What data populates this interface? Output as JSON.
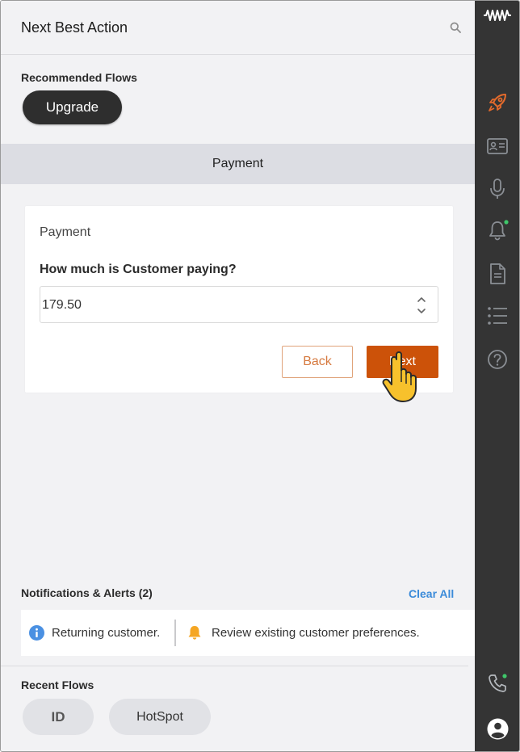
{
  "header": {
    "title": "Next Best Action",
    "search_icon": "search-icon"
  },
  "recommended": {
    "label": "Recommended Flows",
    "flows": [
      {
        "label": "Upgrade"
      }
    ]
  },
  "payment_section": {
    "label": "Payment"
  },
  "card": {
    "title": "Payment",
    "question": "How much is Customer paying?",
    "amount_value": "179.50",
    "back_label": "Back",
    "next_label": "Next"
  },
  "notifications": {
    "label": "Notifications & Alerts (2)",
    "clear_label": "Clear All",
    "items": [
      {
        "icon": "info-icon",
        "text": "Returning customer."
      },
      {
        "icon": "bell-icon",
        "text": "Review existing customer preferences."
      }
    ]
  },
  "recent": {
    "label": "Recent Flows",
    "flows": [
      {
        "label": "ID"
      },
      {
        "label": "HotSpot"
      }
    ]
  },
  "sidebar": {
    "icons": [
      "logo-waveform-icon",
      "rocket-icon",
      "id-card-icon",
      "microphone-icon",
      "bell-icon",
      "document-icon",
      "list-icon",
      "help-icon",
      "phone-icon",
      "user-avatar-icon"
    ]
  },
  "colors": {
    "accent": "#cc5209",
    "link": "#3b8bd9",
    "sidebar_bg": "#343434",
    "active_icon": "#e36a2c",
    "status_green": "#3fc76a"
  }
}
